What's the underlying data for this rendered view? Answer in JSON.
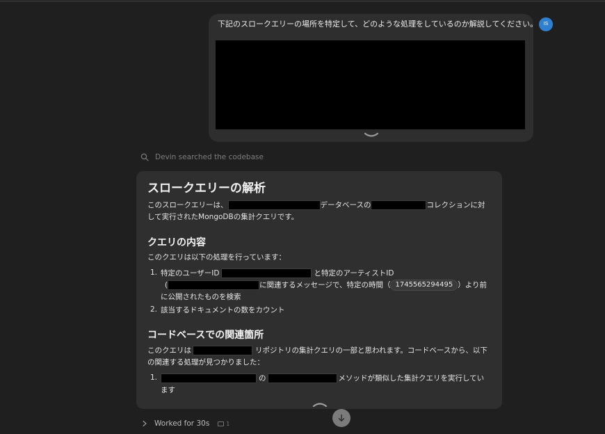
{
  "user_message": {
    "text": "下記のスロークエリーの場所を特定して、どのような処理をしているのか解説してください。",
    "avatar_initials": "IS"
  },
  "search": {
    "label": "Devin searched the codebase"
  },
  "answer": {
    "title": "スロークエリーの解析",
    "intro": {
      "part1": "このスロークエリーは、",
      "part2": "データベースの",
      "part3": "コレクションに対",
      "line2": "して実行されたMongoDBの集計クエリです。"
    },
    "section1_title": "クエリの内容",
    "section1_lead": "このクエリは以下の処理を行っています：",
    "items": [
      {
        "num": "1.",
        "part1": "特定のユーザーID",
        "part2": "と特定のアーティストID",
        "part3": "(",
        "part4": "に関連するメッセージで、特定の時間（",
        "code": "1745565294495",
        "part5": "）より前",
        "line3": "に公開されたものを検索"
      },
      {
        "num": "2.",
        "text": "該当するドキュメントの数をカウント"
      }
    ],
    "section2_title": "コードベースでの関連箇所",
    "section2_lead": {
      "part1": "このクエリは",
      "part2": "リポジトリの集計クエリの一部と思われます。コードベースから、以下",
      "line2": "の関連する処理が見つかりました："
    },
    "found_items": [
      {
        "num": "1.",
        "part1": "の",
        "part2": "メソッドが類似した集計クエリを実行してい",
        "line2": "ます"
      }
    ]
  },
  "footer": {
    "worked_label": "Worked for 30s",
    "count": "1"
  },
  "colors": {
    "background": "#1f1f1f",
    "bubble": "#2e2e2e",
    "card": "#2f2f2f",
    "avatar": "#2f7fd0",
    "redaction": "#000000"
  }
}
